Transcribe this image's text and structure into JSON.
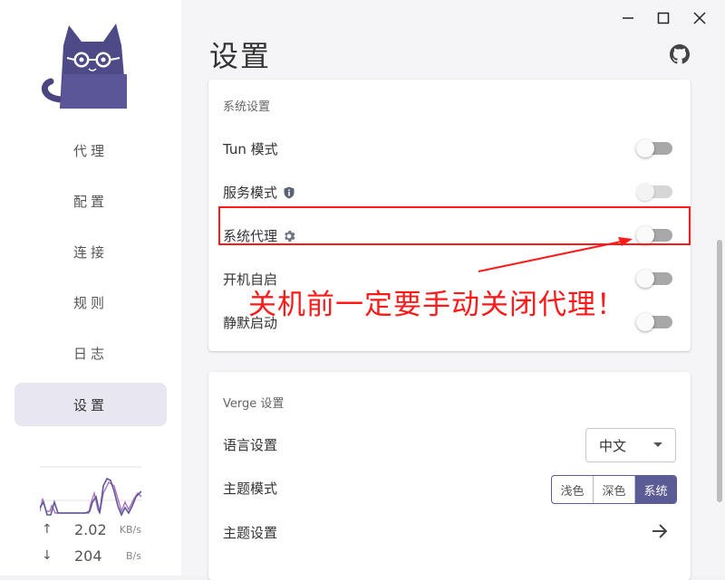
{
  "window": {
    "minimize_icon": "minimize-icon",
    "maximize_icon": "maximize-icon",
    "close_icon": "close-icon"
  },
  "sidebar": {
    "items": [
      {
        "label": "代理",
        "active": false
      },
      {
        "label": "配置",
        "active": false
      },
      {
        "label": "连接",
        "active": false
      },
      {
        "label": "规则",
        "active": false
      },
      {
        "label": "日志",
        "active": false
      },
      {
        "label": "设置",
        "active": true
      }
    ],
    "traffic": {
      "upload_arrow": "↑",
      "upload_value": "2.02",
      "upload_unit": "KB/s",
      "download_arrow": "↓",
      "download_value": "204",
      "download_unit": "B/s"
    }
  },
  "header": {
    "title": "设置",
    "github_icon": "github-icon"
  },
  "system_settings": {
    "title": "系统设置",
    "rows": [
      {
        "label": "Tun 模式",
        "on": false,
        "disabled": false
      },
      {
        "label": "服务模式",
        "icon": "shield-info-icon",
        "on": false,
        "disabled": true
      },
      {
        "label": "系统代理",
        "icon": "gear-icon",
        "on": false,
        "disabled": false
      },
      {
        "label": "开机自启",
        "on": false,
        "disabled": false
      },
      {
        "label": "静默启动",
        "on": false,
        "disabled": false
      }
    ]
  },
  "verge_settings": {
    "title": "Verge 设置",
    "language_label": "语言设置",
    "language_value": "中文",
    "theme_mode_label": "主题模式",
    "theme_modes": [
      "浅色",
      "深色",
      "系统"
    ],
    "theme_mode_selected": "系统",
    "theme_settings_label": "主题设置"
  },
  "annotation": {
    "text": "关机前一定要手动关闭代理！",
    "color": "#ff1a1a"
  },
  "colors": {
    "accent": "#5b5b96",
    "active_nav_bg": "#e8e7f1",
    "upload_line": "#5b5b96",
    "download_line": "#b06fc0"
  }
}
